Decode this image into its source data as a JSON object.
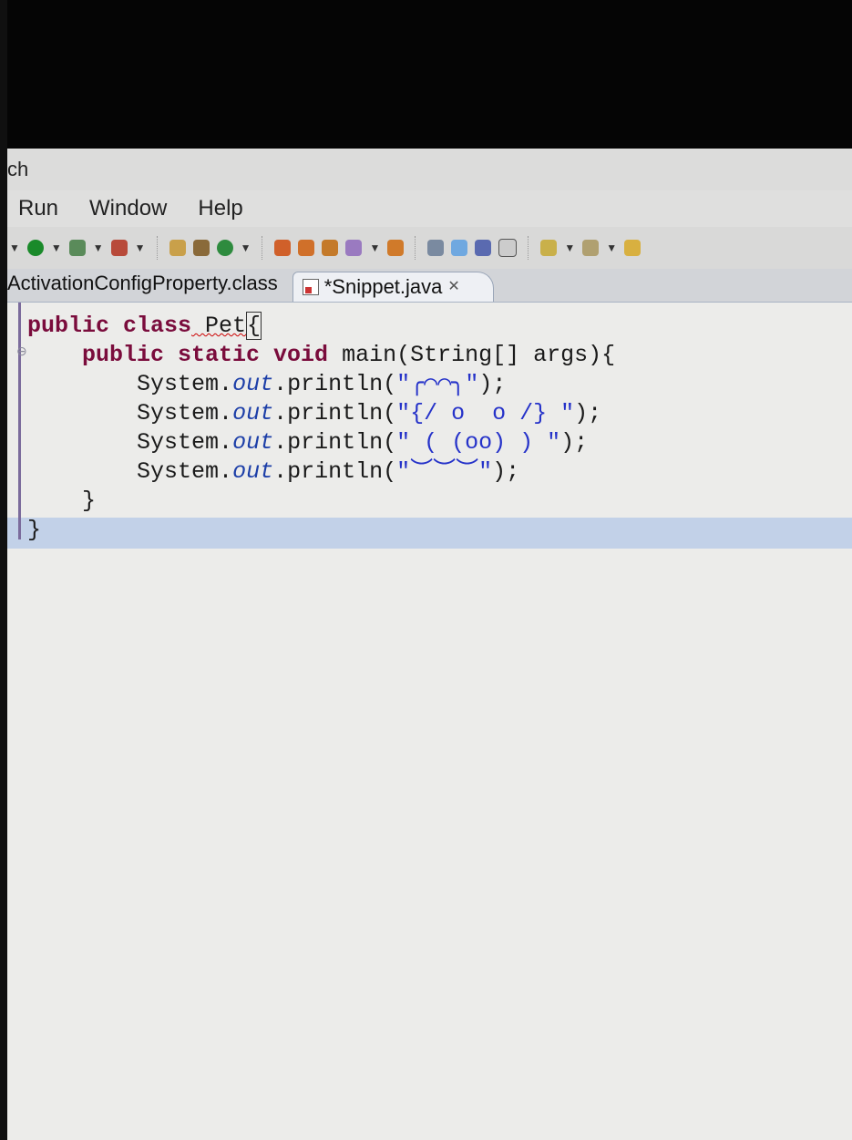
{
  "titlebar": {
    "text": "ch"
  },
  "menu": {
    "run": "Run",
    "window": "Window",
    "help": "Help"
  },
  "tabs": [
    {
      "label": "ActivationConfigProperty.class"
    },
    {
      "label": "*Snippet.java",
      "close": "✕"
    }
  ],
  "code": {
    "l1_kw": "public class",
    "l1_rest": " Pet",
    "l1_brace": "{",
    "l2_kw": "public static void",
    "l2_rest": " main(String[] args){",
    "sys": "System.",
    "out": "out",
    "println": ".println(",
    "s1": "\"╭⌒⌒╮\"",
    "s2": "\"{/ o  o /} \"",
    "s3": "\" ( (oo) ) \"",
    "s4": "\"︶︶︶\"",
    "end": ");",
    "close_inner": "}",
    "close_outer": "}"
  }
}
